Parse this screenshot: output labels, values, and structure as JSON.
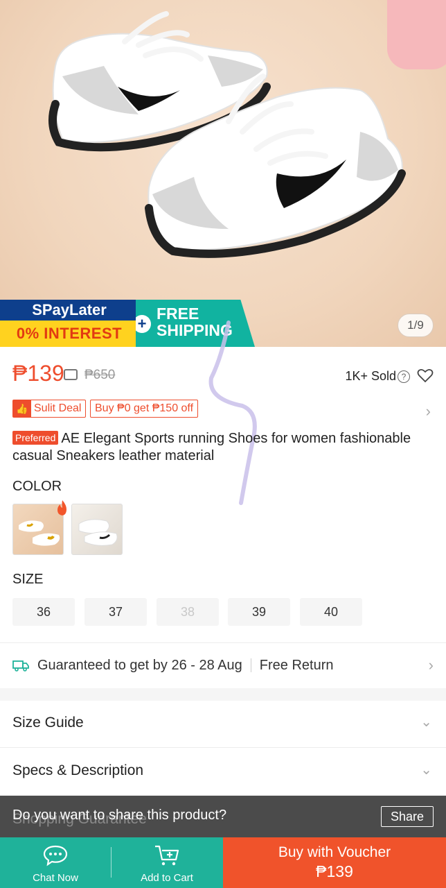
{
  "hero": {
    "image_counter": "1/9",
    "promo": {
      "paylater_brand": "SPayLater",
      "paylater_offer": "0% INTEREST",
      "shipping_line1": "FREE",
      "shipping_line2": "SHIPPING"
    }
  },
  "product": {
    "price": "₱139",
    "original_price": "₱650",
    "sold": "1K+ Sold",
    "deal_tag": "Sulit Deal",
    "voucher_tag": "Buy ₱0 get ₱150 off",
    "preferred_badge": "Preferred",
    "title": "AE Elegant Sports running Shoes for women fashionable casual Sneakers leather material"
  },
  "variations": {
    "color_label": "COLOR",
    "size_label": "SIZE",
    "sizes": [
      {
        "label": "36",
        "available": true
      },
      {
        "label": "37",
        "available": true
      },
      {
        "label": "38",
        "available": false
      },
      {
        "label": "39",
        "available": true
      },
      {
        "label": "40",
        "available": true
      }
    ]
  },
  "delivery": {
    "guarantee": "Guaranteed to get by 26 - 28 Aug",
    "return": "Free Return"
  },
  "sections": {
    "size_guide": "Size Guide",
    "specs": "Specs & Description",
    "shopping_guarantee": "Shopping Guarantee"
  },
  "share_prompt": {
    "question": "Do you want to share this product?",
    "button": "Share"
  },
  "bottom_bar": {
    "chat": "Chat Now",
    "cart": "Add to Cart",
    "buy_line1": "Buy with Voucher",
    "buy_line2": "₱139"
  },
  "colors": {
    "accent": "#ee4d2d",
    "teal": "#1fb29a",
    "buy_button": "#f0532b"
  }
}
